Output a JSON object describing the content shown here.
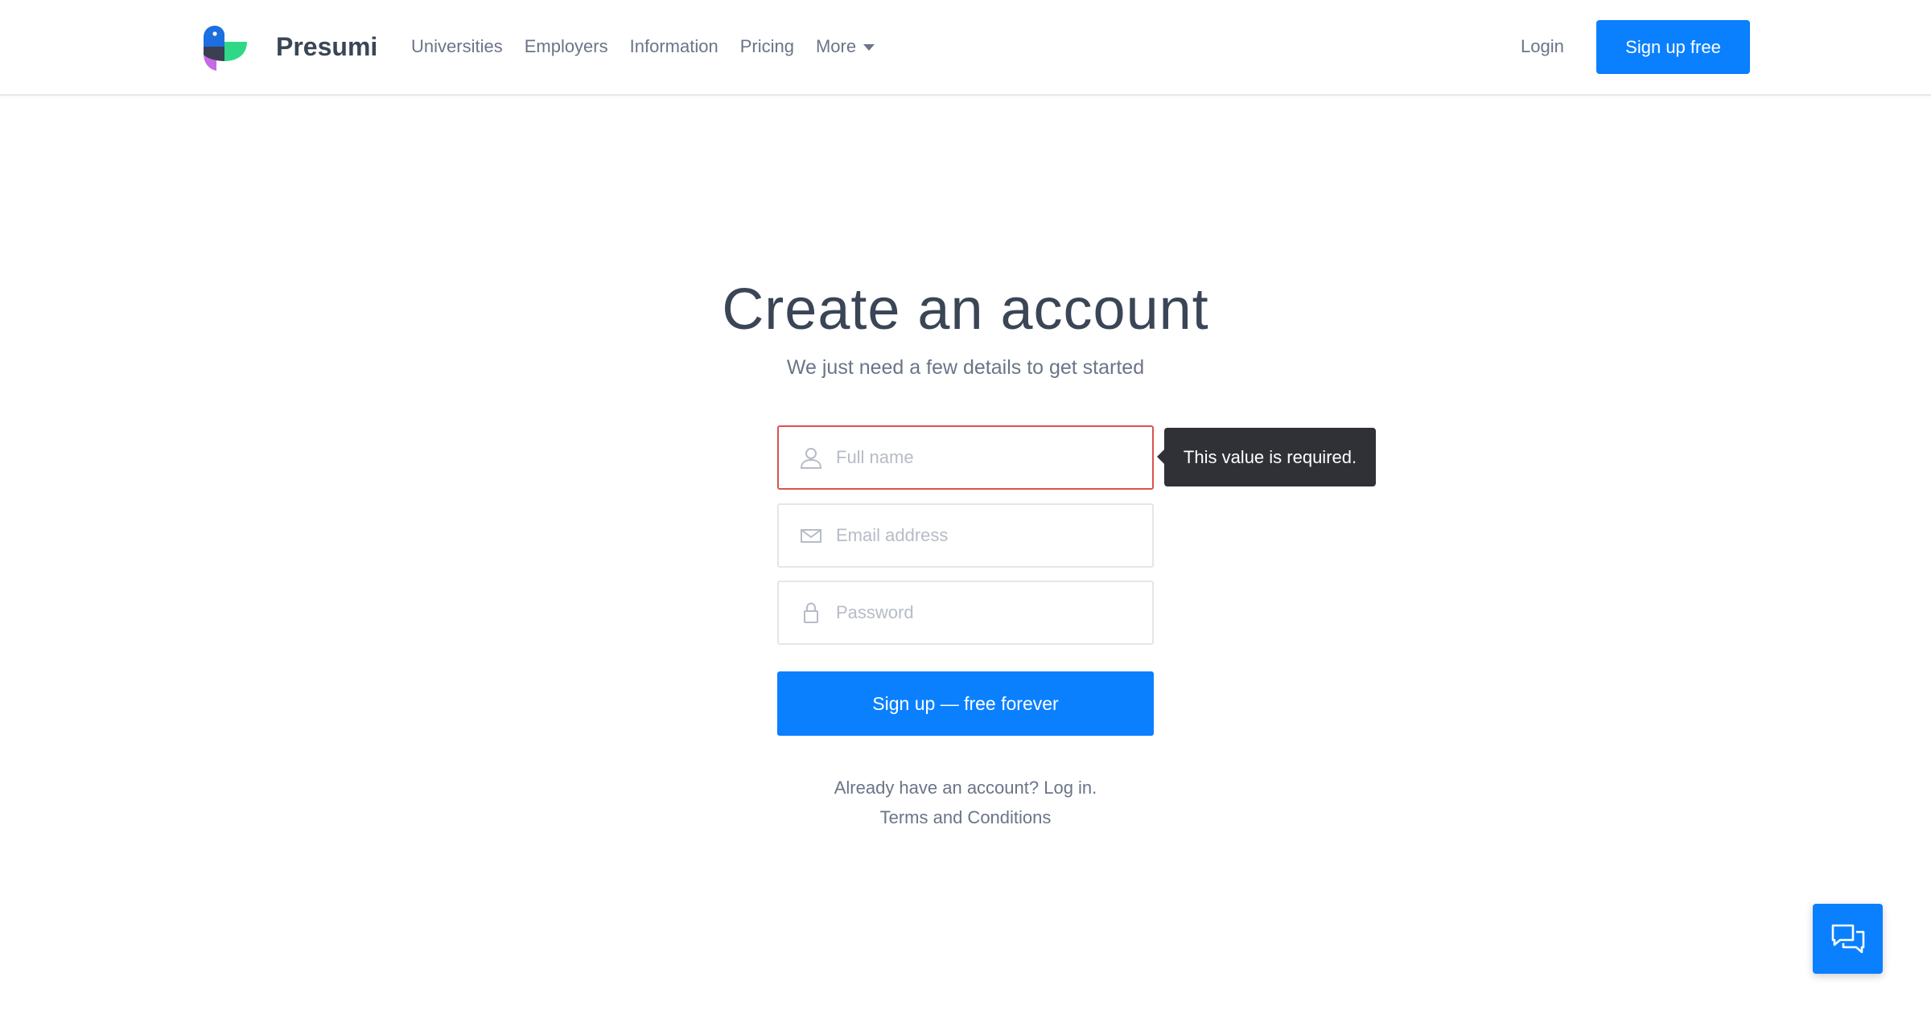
{
  "header": {
    "brand": "Presumi",
    "nav": [
      {
        "label": "Universities"
      },
      {
        "label": "Employers"
      },
      {
        "label": "Information"
      },
      {
        "label": "Pricing"
      },
      {
        "label": "More"
      }
    ],
    "login_label": "Login",
    "signup_label": "Sign up free"
  },
  "main": {
    "title": "Create an account",
    "subtitle": "We just need a few details to get started",
    "fields": {
      "full_name": {
        "placeholder": "Full name",
        "value": ""
      },
      "email": {
        "placeholder": "Email address",
        "value": ""
      },
      "password": {
        "placeholder": "Password",
        "value": ""
      }
    },
    "tooltip": "This value is required.",
    "submit_label": "Sign up — free forever",
    "login_prompt": "Already have an account? Log in.",
    "terms_label": "Terms and Conditions"
  },
  "icons": {
    "logo": "bird-logo-icon",
    "user": "user-icon",
    "email": "envelope-icon",
    "password": "lock-icon",
    "chat": "chat-bubbles-icon"
  },
  "colors": {
    "accent": "#0a80ff",
    "error_border": "#d9534f",
    "tooltip_bg": "#2f3136",
    "text_dark": "#3a4556",
    "text_muted": "#6b7487"
  }
}
